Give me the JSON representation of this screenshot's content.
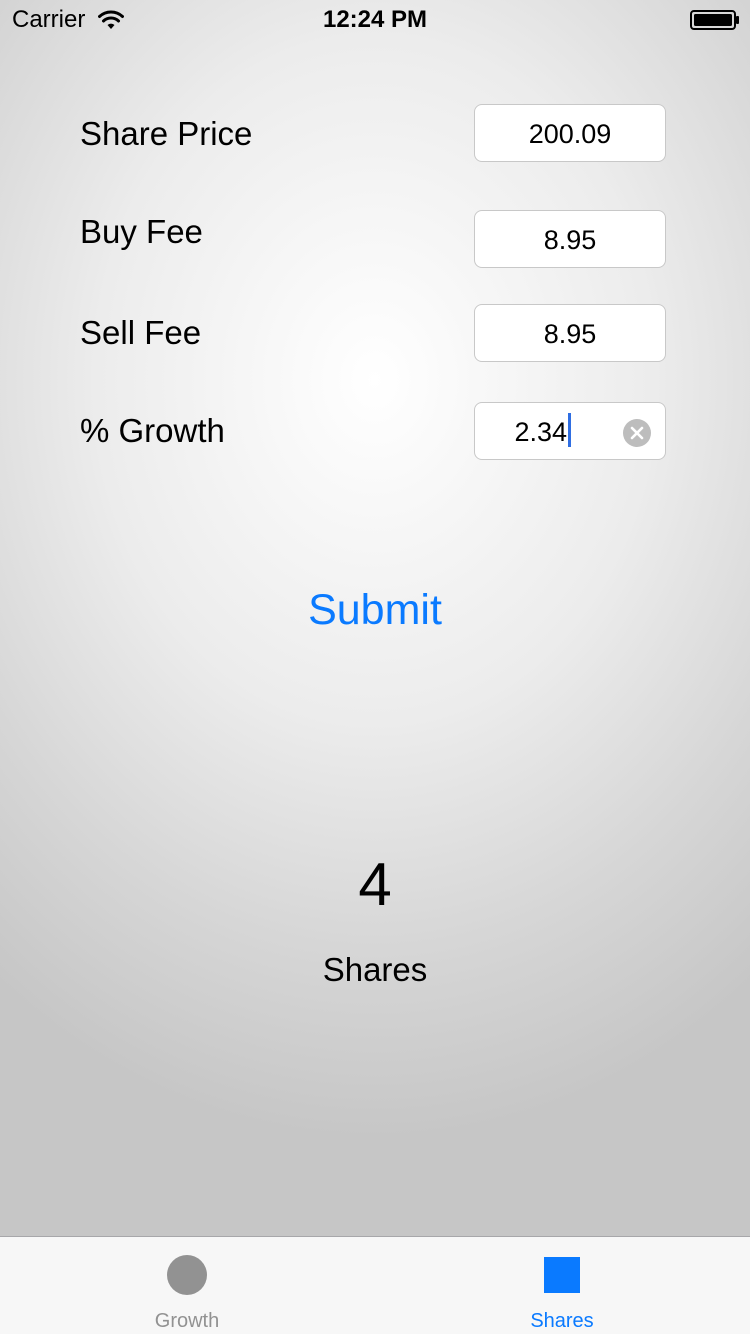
{
  "status_bar": {
    "carrier": "Carrier",
    "time": "12:24 PM"
  },
  "form": {
    "share_price": {
      "label": "Share Price",
      "value": "200.09"
    },
    "buy_fee": {
      "label": "Buy Fee",
      "value": "8.95"
    },
    "sell_fee": {
      "label": "Sell Fee",
      "value": "8.95"
    },
    "growth": {
      "label": "% Growth",
      "value": "2.34"
    }
  },
  "submit_label": "Submit",
  "result": {
    "value": "4",
    "label": "Shares"
  },
  "tabs": [
    {
      "label": "Growth",
      "icon": "circle-icon",
      "color": "#929292",
      "selected": false
    },
    {
      "label": "Shares",
      "icon": "square-icon",
      "color": "#0a7aff",
      "selected": true
    }
  ],
  "colors": {
    "accent": "#0a7aff",
    "inactive": "#929292",
    "caret": "#2f6ee2"
  }
}
